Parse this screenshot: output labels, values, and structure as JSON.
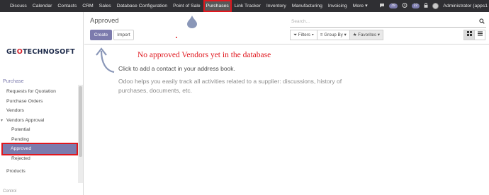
{
  "navbar": {
    "items": [
      "Discuss",
      "Calendar",
      "Contacts",
      "CRM",
      "Sales",
      "Database Configuration",
      "Point of Sale",
      "Purchases",
      "Link Tracker",
      "Inventory",
      "Manufacturing",
      "Invoicing",
      "More ▾"
    ],
    "active_index": 7,
    "badge_messages": "39",
    "badge_activities": "22",
    "user_name": "Administrator (apps1"
  },
  "sidebar": {
    "logo_prefix": "GE",
    "logo_o": "O",
    "logo_suffix": "TECHNOSOFT",
    "section": "Purchase",
    "items": [
      {
        "label": "Requests for Quotation"
      },
      {
        "label": "Purchase Orders"
      },
      {
        "label": "Vendors"
      },
      {
        "label": "Vendors Approval"
      },
      {
        "label": "Potential"
      },
      {
        "label": "Pending"
      },
      {
        "label": "Approved"
      },
      {
        "label": "Rejected"
      },
      {
        "label": "Products"
      }
    ],
    "cut_label": "Control"
  },
  "control_panel": {
    "breadcrumb": "Approved",
    "search_placeholder": "Search...",
    "create_label": "Create",
    "import_label": "Import",
    "filters_label": "Filters ▾",
    "group_by_label": "Group By ▾",
    "favorites_label": "Favorites ▾"
  },
  "main": {
    "annotation": "No approved Vendors yet in the database",
    "help_title": "Click to add a contact in your address book.",
    "help_text": "Odoo helps you easily track all activities related to a supplier: discussions, history of purchases, documents, etc."
  },
  "colors": {
    "accent": "#7c7bad",
    "navbar": "#2f2f33",
    "highlight": "#e0171e"
  },
  "icons": [
    "apps-grid-icon",
    "chat-icon",
    "activity-icon",
    "lock-icon",
    "filter-icon",
    "group-icon",
    "star-icon",
    "kanban-icon",
    "list-icon",
    "search-icon",
    "arrow-annotation-icon"
  ]
}
